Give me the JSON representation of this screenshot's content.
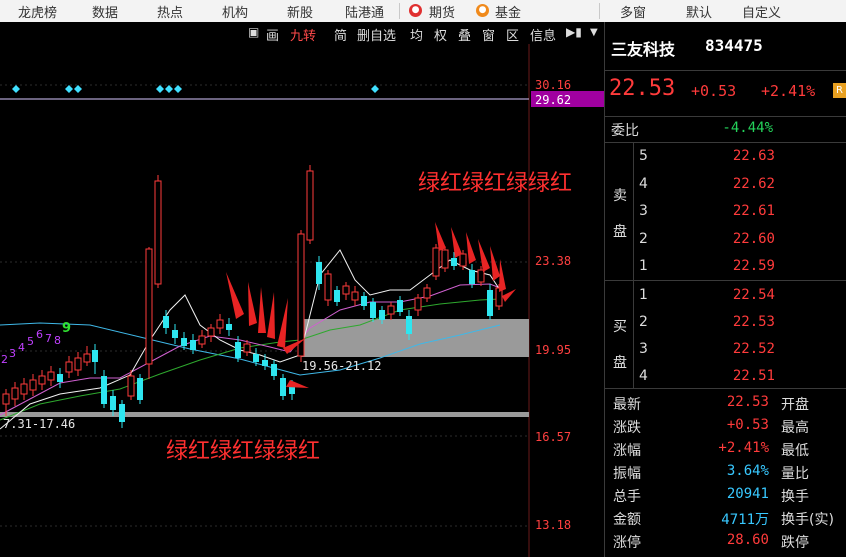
{
  "top_nav": {
    "items": [
      "龙虎榜",
      "数据",
      "热点",
      "机构",
      "新股",
      "陆港通",
      "期货",
      "基金",
      "多窗",
      "默认",
      "自定义"
    ]
  },
  "toolbar": {
    "items": [
      "画",
      "九转",
      "简",
      "删自选",
      "均",
      "权",
      "叠",
      "窗",
      "区",
      "信息"
    ],
    "active": "九转"
  },
  "chart": {
    "y_ticks": [
      "30.16",
      "23.38",
      "19.95",
      "16.57",
      "13.18"
    ],
    "highlight_price": "29.62",
    "range_label_1": "19.56-21.12",
    "range_label_2": "7.31-17.46",
    "annotation_1": "绿红绿红绿绿红",
    "annotation_2": "绿红绿红绿绿红",
    "td_numbers": [
      "2",
      "3",
      "4",
      "5",
      "6",
      "7",
      "8",
      "9"
    ],
    "colors": {
      "up": "#ff3b3b",
      "down": "#2ee6f0",
      "highlight": "#b000b0",
      "zone": "#9a9a9a"
    }
  },
  "stock": {
    "name": "三友科技",
    "code": "834475",
    "price": "22.53",
    "change": "+0.53",
    "change_pct": "+2.41%",
    "badge": "R"
  },
  "order_book": {
    "weibi_label": "委比",
    "weibi_value": "-4.44%",
    "sell_label": [
      "卖",
      "盘"
    ],
    "buy_label": [
      "买",
      "盘"
    ],
    "asks": [
      {
        "level": "5",
        "price": "22.63"
      },
      {
        "level": "4",
        "price": "22.62"
      },
      {
        "level": "3",
        "price": "22.61"
      },
      {
        "level": "2",
        "price": "22.60"
      },
      {
        "level": "1",
        "price": "22.59"
      }
    ],
    "bids": [
      {
        "level": "1",
        "price": "22.54"
      },
      {
        "level": "2",
        "price": "22.53"
      },
      {
        "level": "3",
        "price": "22.52"
      },
      {
        "level": "4",
        "price": "22.51"
      }
    ]
  },
  "stats": [
    {
      "label": "最新",
      "value": "22.53",
      "right": "开盘"
    },
    {
      "label": "涨跌",
      "value": "+0.53",
      "right": "最高"
    },
    {
      "label": "涨幅",
      "value": "+2.41%",
      "right": "最低"
    },
    {
      "label": "振幅",
      "value": "3.64%",
      "right": "量比"
    },
    {
      "label": "总手",
      "value": "20941",
      "right": "换手"
    },
    {
      "label": "金额",
      "value": "4711万",
      "right": "换手(实)"
    },
    {
      "label": "涨停",
      "value": "28.60",
      "right": "跌停"
    }
  ]
}
